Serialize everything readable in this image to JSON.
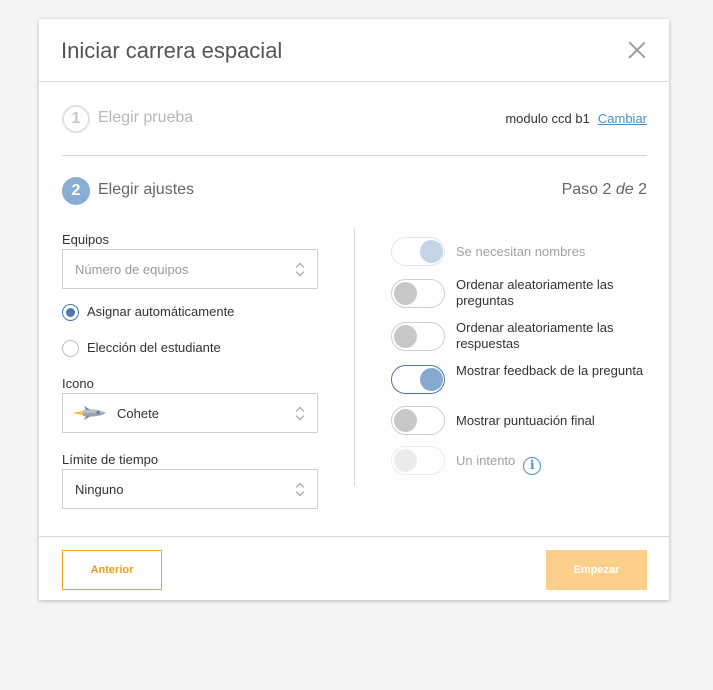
{
  "modal": {
    "title": "Iniciar carrera espacial"
  },
  "step1": {
    "number": "1",
    "label": "Elegir prueba",
    "quiz_name": "modulo ccd b1",
    "change_link": "Cambiar"
  },
  "step2": {
    "number": "2",
    "label": "Elegir ajustes",
    "progress_prefix": "Paso 2",
    "progress_of": "de",
    "progress_total": "2"
  },
  "teams": {
    "label": "Equipos",
    "placeholder": "Número de equipos",
    "options": [
      {
        "label": "Asignar automáticamente",
        "checked": true
      },
      {
        "label": "Elección del estudiante",
        "checked": false
      }
    ]
  },
  "icon_field": {
    "label": "Icono",
    "value": "Cohete",
    "icon": "rocket-icon"
  },
  "time_limit": {
    "label": "Límite de tiempo",
    "value": "Ninguno"
  },
  "toggles": [
    {
      "label": "Se necesitan nombres",
      "state": "on",
      "disabled": true
    },
    {
      "label": "Ordenar aleatoriamente las preguntas",
      "state": "off",
      "disabled": false
    },
    {
      "label": "Ordenar aleatoriamente las respuestas",
      "state": "off",
      "disabled": false
    },
    {
      "label": "Mostrar feedback de la pregunta",
      "state": "on",
      "disabled": false
    },
    {
      "label": "Mostrar puntuación final",
      "state": "off",
      "disabled": false
    },
    {
      "label": "Un intento",
      "state": "off",
      "disabled": true,
      "info_icon": "info-icon"
    }
  ],
  "footer": {
    "prev_label": "Anterior",
    "start_label": "Empezar"
  },
  "colors": {
    "accent_orange": "#f09a1c",
    "start_disabled": "#fcd08a",
    "toggle_blue": "#86a9cf",
    "link_blue": "#4a90c8"
  }
}
